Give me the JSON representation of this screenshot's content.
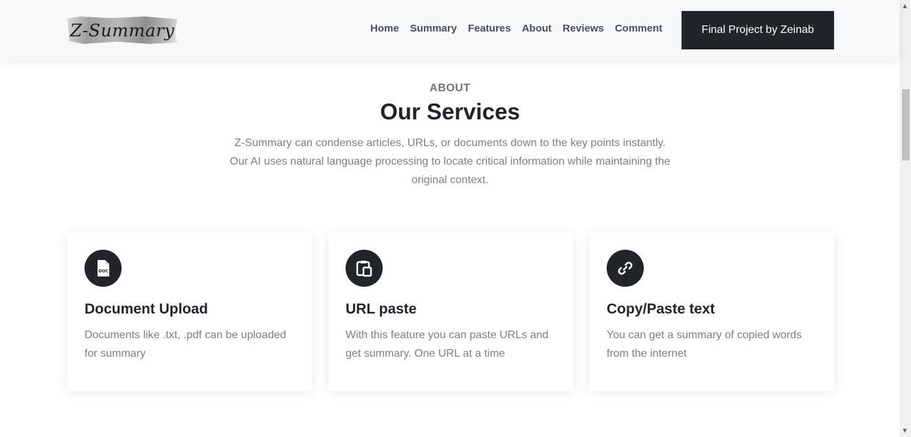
{
  "header": {
    "logo_text": "Z-Summary",
    "nav": [
      "Home",
      "Summary",
      "Features",
      "About",
      "Reviews",
      "Comment"
    ],
    "cta_label": "Final Project by Zeinab"
  },
  "section": {
    "eyebrow": "ABOUT",
    "title": "Our Services",
    "description_lines": [
      "Z-Summary can condense articles, URLs, or documents down to the key points instantly.",
      "Our AI uses natural language processing to locate critical information while maintaining the",
      "original context."
    ]
  },
  "cards": [
    {
      "icon": "document-icon",
      "title": "Document Upload",
      "text": "Documents like .txt, .pdf can be uploaded for summary"
    },
    {
      "icon": "clipboard-icon",
      "title": "URL paste",
      "text": "With this feature you can paste URLs and get summary. One URL at a time"
    },
    {
      "icon": "link-icon",
      "title": "Copy/Paste text",
      "text": "You can get a summary of copied words from the internet"
    }
  ],
  "colors": {
    "dark": "#212529",
    "muted_text": "#7a7f85",
    "header_bg": "#f7f8fa"
  }
}
